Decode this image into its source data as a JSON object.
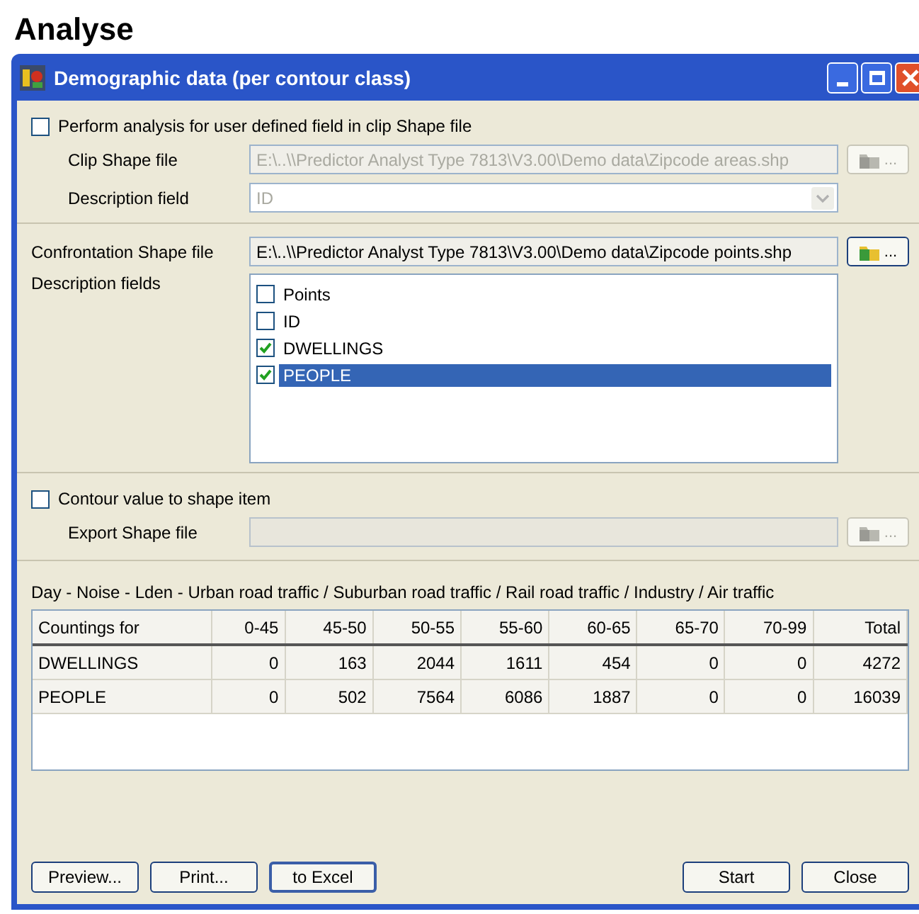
{
  "heading": "Analyse",
  "window": {
    "title": "Demographic data (per contour class)"
  },
  "clip_section": {
    "checkbox": {
      "label": "Perform analysis for user defined field in clip Shape file",
      "checked": false
    },
    "clip_file": {
      "label": "Clip Shape file",
      "value": "E:\\..\\\\Predictor Analyst Type 7813\\V3.00\\Demo data\\Zipcode areas.shp",
      "disabled": true,
      "browse": {
        "label": "...",
        "disabled": true
      }
    },
    "description_field": {
      "label": "Description field",
      "value": "ID",
      "disabled": true
    }
  },
  "confrontation": {
    "label": "Confrontation Shape file",
    "value": "E:\\..\\\\Predictor Analyst Type 7813\\V3.00\\Demo data\\Zipcode points.shp",
    "browse": {
      "label": "...",
      "disabled": false
    }
  },
  "description_fields": {
    "label": "Description fields",
    "items": [
      {
        "label": "Points",
        "checked": false,
        "selected": false
      },
      {
        "label": "ID",
        "checked": false,
        "selected": false
      },
      {
        "label": "DWELLINGS",
        "checked": true,
        "selected": false
      },
      {
        "label": "PEOPLE",
        "checked": true,
        "selected": true
      }
    ]
  },
  "export_section": {
    "checkbox": {
      "label": "Contour value to shape item",
      "checked": false
    },
    "export_file": {
      "label": "Export Shape file",
      "disabled": true,
      "browse": {
        "label": "...",
        "disabled": true
      }
    }
  },
  "results": {
    "caption": "Day - Noise - Lden - Urban road traffic / Suburban road traffic / Rail road traffic / Industry / Air traffic",
    "columns": [
      "Countings for",
      "0-45",
      "45-50",
      "50-55",
      "55-60",
      "60-65",
      "65-70",
      "70-99",
      "Total"
    ],
    "rows": [
      [
        "DWELLINGS",
        "0",
        "163",
        "2044",
        "1611",
        "454",
        "0",
        "0",
        "4272"
      ],
      [
        "PEOPLE",
        "0",
        "502",
        "7564",
        "6086",
        "1887",
        "0",
        "0",
        "16039"
      ]
    ]
  },
  "left_buttons": [
    {
      "label": "Preview...",
      "focused": false
    },
    {
      "label": "Print...",
      "focused": false
    },
    {
      "label": "to Excel",
      "focused": true
    }
  ],
  "right_buttons": [
    {
      "label": "Start",
      "focused": false
    },
    {
      "label": "Close",
      "focused": false
    }
  ]
}
